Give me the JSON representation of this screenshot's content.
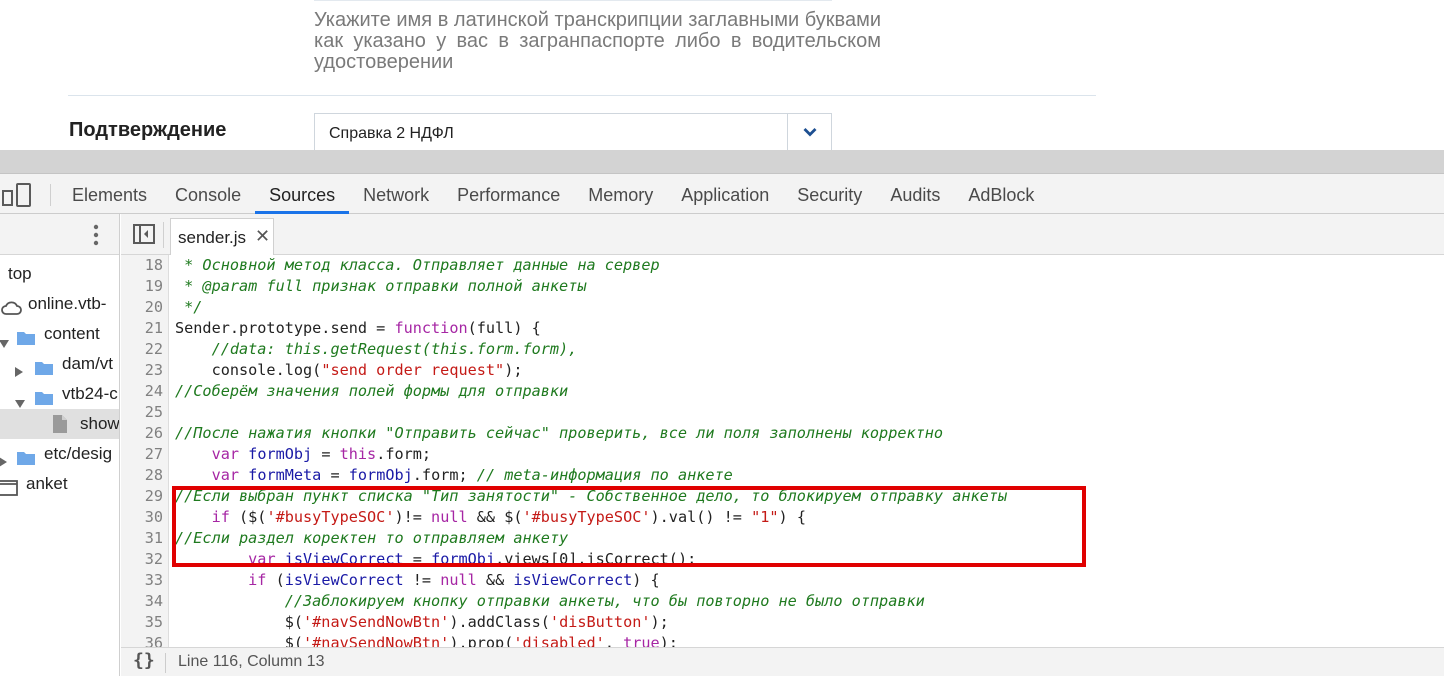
{
  "page": {
    "hint": "Укажите имя в латинской транскрипции заглавными буквами как указано у вас в загранпаспорте либо в водительском удостоверении",
    "field_label": "Подтверждение",
    "select_value": "Справка 2 НДФЛ",
    "select_icon": "chevron-down-icon"
  },
  "devtools": {
    "tabs": [
      "Elements",
      "Console",
      "Sources",
      "Network",
      "Performance",
      "Memory",
      "Application",
      "Security",
      "Audits",
      "AdBlock"
    ],
    "active_tab": "Sources",
    "navigator": {
      "items": [
        {
          "label": "top",
          "icon": "frame-icon",
          "indent": 0
        },
        {
          "label": "online.vtb-",
          "icon": "cloud-icon",
          "indent": 0
        },
        {
          "label": "content",
          "icon": "folder-icon",
          "indent": 1,
          "arrow": "down"
        },
        {
          "label": "dam/vt",
          "icon": "folder-icon",
          "indent": 2,
          "arrow": "right"
        },
        {
          "label": "vtb24-c",
          "icon": "folder-icon",
          "indent": 2,
          "arrow": "down"
        },
        {
          "label": "show",
          "icon": "file-icon",
          "indent": 3,
          "selected": true
        },
        {
          "label": "etc/desig",
          "icon": "folder-icon",
          "indent": 1,
          "arrow": "right"
        },
        {
          "label": "anket",
          "icon": "frame-icon",
          "indent": 0
        }
      ]
    },
    "open_file": "sender.js",
    "status": "Line 116, Column 13",
    "highlight_color": "#e00000",
    "code_lines": [
      {
        "n": "18",
        "parts": [
          {
            "c": "cm",
            "t": " * Основной метод класса. Отправляет данные на сервер"
          }
        ]
      },
      {
        "n": "19",
        "parts": [
          {
            "c": "cm",
            "t": " * @param full признак отправки полной анкеты"
          }
        ]
      },
      {
        "n": "20",
        "parts": [
          {
            "c": "cm",
            "t": " */"
          }
        ]
      },
      {
        "n": "21",
        "parts": [
          {
            "c": "",
            "t": "Sender.prototype.send = "
          },
          {
            "c": "kw",
            "t": "function"
          },
          {
            "c": "",
            "t": "(full) {"
          }
        ]
      },
      {
        "n": "22",
        "parts": [
          {
            "c": "cm",
            "t": "    //data: this.getRequest(this.form.form),"
          }
        ]
      },
      {
        "n": "23",
        "parts": [
          {
            "c": "",
            "t": "    console.log("
          },
          {
            "c": "str",
            "t": "\"send order request\""
          },
          {
            "c": "",
            "t": ");"
          }
        ]
      },
      {
        "n": "24",
        "parts": [
          {
            "c": "cm",
            "t": "//Соберём значения полей формы для отправки"
          }
        ]
      },
      {
        "n": "25",
        "parts": [
          {
            "c": "",
            "t": ""
          }
        ]
      },
      {
        "n": "26",
        "parts": [
          {
            "c": "cm",
            "t": "//После нажатия кнопки \"Отправить сейчас\" проверить, все ли поля заполнены корректно"
          }
        ]
      },
      {
        "n": "27",
        "parts": [
          {
            "c": "",
            "t": "    "
          },
          {
            "c": "kw",
            "t": "var"
          },
          {
            "c": "",
            "t": " "
          },
          {
            "c": "ident",
            "t": "formObj"
          },
          {
            "c": "",
            "t": " = "
          },
          {
            "c": "kw",
            "t": "this"
          },
          {
            "c": "",
            "t": ".form;"
          }
        ]
      },
      {
        "n": "28",
        "parts": [
          {
            "c": "",
            "t": "    "
          },
          {
            "c": "kw",
            "t": "var"
          },
          {
            "c": "",
            "t": " "
          },
          {
            "c": "ident",
            "t": "formMeta"
          },
          {
            "c": "",
            "t": " = "
          },
          {
            "c": "ident",
            "t": "formObj"
          },
          {
            "c": "",
            "t": ".form; "
          },
          {
            "c": "cm",
            "t": "// meta-информация по анкете"
          }
        ]
      },
      {
        "n": "29",
        "parts": [
          {
            "c": "cm",
            "t": "//Если выбран пункт списка \"Тип занятости\" - Собственное дело, то блокируем отправку анкеты"
          }
        ]
      },
      {
        "n": "30",
        "parts": [
          {
            "c": "",
            "t": "    "
          },
          {
            "c": "kw",
            "t": "if"
          },
          {
            "c": "",
            "t": " ($("
          },
          {
            "c": "str",
            "t": "'#busyTypeSOC'"
          },
          {
            "c": "",
            "t": ")!= "
          },
          {
            "c": "kw",
            "t": "null"
          },
          {
            "c": "",
            "t": " && $("
          },
          {
            "c": "str",
            "t": "'#busyTypeSOC'"
          },
          {
            "c": "",
            "t": ").val() != "
          },
          {
            "c": "str",
            "t": "\"1\""
          },
          {
            "c": "",
            "t": ") {"
          }
        ]
      },
      {
        "n": "31",
        "parts": [
          {
            "c": "cm",
            "t": "//Если раздел коректен то отправляем анкету"
          }
        ]
      },
      {
        "n": "32",
        "parts": [
          {
            "c": "",
            "t": "        "
          },
          {
            "c": "kw",
            "t": "var"
          },
          {
            "c": "",
            "t": " "
          },
          {
            "c": "ident",
            "t": "isViewCorrect"
          },
          {
            "c": "",
            "t": " = "
          },
          {
            "c": "ident",
            "t": "formObj"
          },
          {
            "c": "",
            "t": ".views[0].isCorrect();"
          }
        ]
      },
      {
        "n": "33",
        "parts": [
          {
            "c": "",
            "t": "        "
          },
          {
            "c": "kw",
            "t": "if"
          },
          {
            "c": "",
            "t": " ("
          },
          {
            "c": "ident",
            "t": "isViewCorrect"
          },
          {
            "c": "",
            "t": " != "
          },
          {
            "c": "kw",
            "t": "null"
          },
          {
            "c": "",
            "t": " && "
          },
          {
            "c": "ident",
            "t": "isViewCorrect"
          },
          {
            "c": "",
            "t": ") {"
          }
        ]
      },
      {
        "n": "34",
        "parts": [
          {
            "c": "cm",
            "t": "            //Заблокируем кнопку отправки анкеты, что бы повторно не было отправки"
          }
        ]
      },
      {
        "n": "35",
        "parts": [
          {
            "c": "",
            "t": "            $("
          },
          {
            "c": "str",
            "t": "'#navSendNowBtn'"
          },
          {
            "c": "",
            "t": ").addClass("
          },
          {
            "c": "str",
            "t": "'disButton'"
          },
          {
            "c": "",
            "t": ");"
          }
        ]
      },
      {
        "n": "36",
        "parts": [
          {
            "c": "",
            "t": "            $("
          },
          {
            "c": "str",
            "t": "'#navSendNowBtn'"
          },
          {
            "c": "",
            "t": ").prop("
          },
          {
            "c": "str",
            "t": "'disabled'"
          },
          {
            "c": "",
            "t": ", "
          },
          {
            "c": "kw",
            "t": "true"
          },
          {
            "c": "",
            "t": ");"
          }
        ]
      }
    ]
  }
}
